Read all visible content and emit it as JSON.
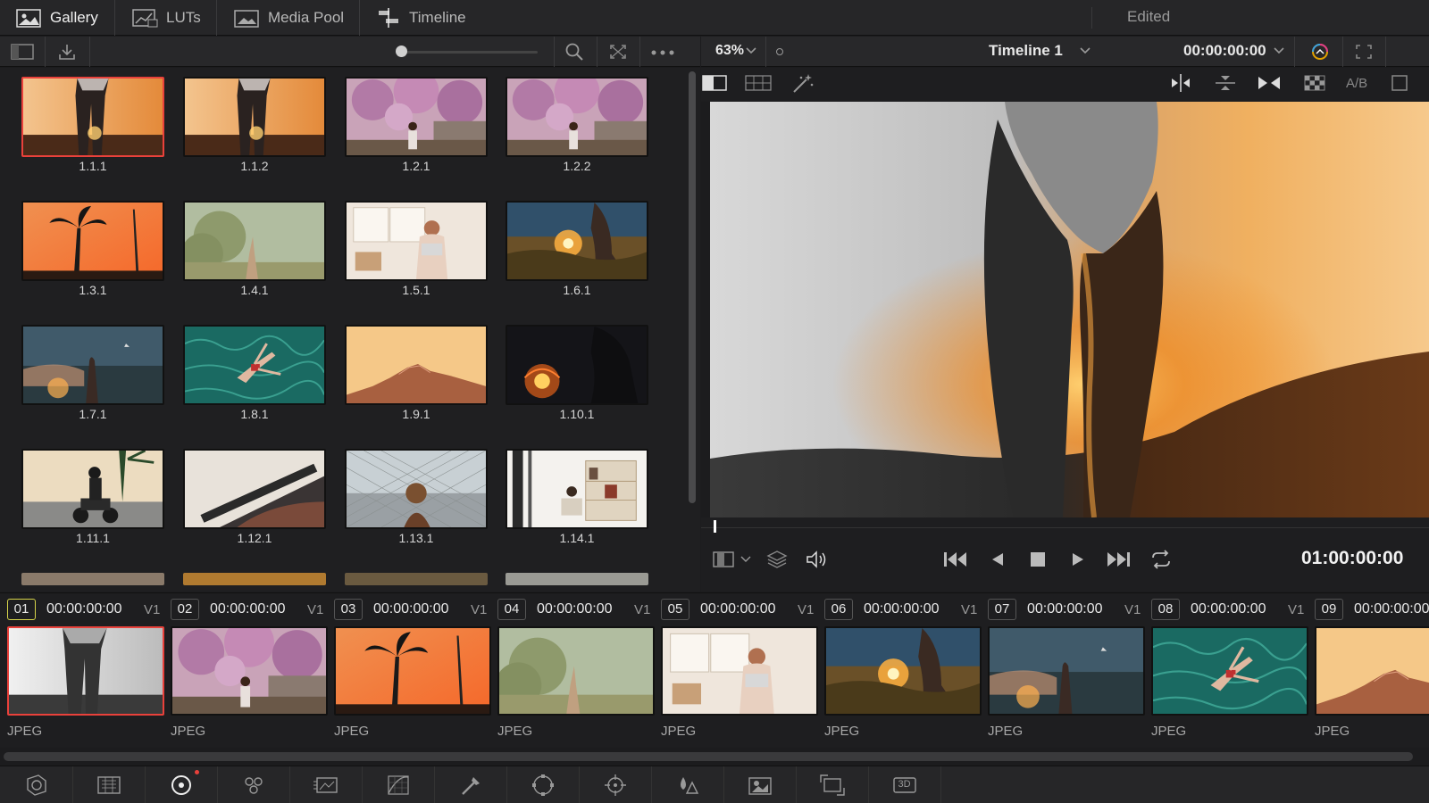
{
  "tabs": [
    {
      "label": "Gallery",
      "icon": "gallery-icon",
      "active": true
    },
    {
      "label": "LUTs",
      "icon": "luts-icon",
      "active": false
    },
    {
      "label": "Media Pool",
      "icon": "media-pool-icon",
      "active": false
    },
    {
      "label": "Timeline",
      "icon": "timeline-icon",
      "active": false
    }
  ],
  "status": "Edited",
  "viewer": {
    "zoom": "63%",
    "timeline_name": "Timeline 1",
    "timecode": "00:00:00:00",
    "ab_label": "A/B",
    "playhead_tc": "01:00:00:00"
  },
  "stills": [
    {
      "label": "1.1.1",
      "scene": "legs"
    },
    {
      "label": "1.1.2",
      "scene": "legs"
    },
    {
      "label": "1.2.1",
      "scene": "blossom"
    },
    {
      "label": "1.2.2",
      "scene": "blossom"
    },
    {
      "label": "1.3.1",
      "scene": "palm"
    },
    {
      "label": "1.4.1",
      "scene": "hill"
    },
    {
      "label": "1.5.1",
      "scene": "room"
    },
    {
      "label": "1.6.1",
      "scene": "field"
    },
    {
      "label": "1.7.1",
      "scene": "beach"
    },
    {
      "label": "1.8.1",
      "scene": "pool"
    },
    {
      "label": "1.9.1",
      "scene": "desert"
    },
    {
      "label": "1.10.1",
      "scene": "fire"
    },
    {
      "label": "1.11.1",
      "scene": "moto"
    },
    {
      "label": "1.12.1",
      "scene": "car"
    },
    {
      "label": "1.13.1",
      "scene": "fence"
    },
    {
      "label": "1.14.1",
      "scene": "shelf"
    }
  ],
  "clips": [
    {
      "num": "01",
      "tc": "00:00:00:00",
      "track": "V1",
      "format": "JPEG",
      "scene": "bwlegs"
    },
    {
      "num": "02",
      "tc": "00:00:00:00",
      "track": "V1",
      "format": "JPEG",
      "scene": "blossom"
    },
    {
      "num": "03",
      "tc": "00:00:00:00",
      "track": "V1",
      "format": "JPEG",
      "scene": "palm"
    },
    {
      "num": "04",
      "tc": "00:00:00:00",
      "track": "V1",
      "format": "JPEG",
      "scene": "hill"
    },
    {
      "num": "05",
      "tc": "00:00:00:00",
      "track": "V1",
      "format": "JPEG",
      "scene": "room"
    },
    {
      "num": "06",
      "tc": "00:00:00:00",
      "track": "V1",
      "format": "JPEG",
      "scene": "field"
    },
    {
      "num": "07",
      "tc": "00:00:00:00",
      "track": "V1",
      "format": "JPEG",
      "scene": "beach"
    },
    {
      "num": "08",
      "tc": "00:00:00:00",
      "track": "V1",
      "format": "JPEG",
      "scene": "pool"
    },
    {
      "num": "09",
      "tc": "00:00:00:00",
      "track": "V1",
      "format": "JPEG",
      "scene": "desert"
    }
  ],
  "bottom_tools": [
    "camera-raw-icon",
    "color-match-icon",
    "color-wheels-icon",
    "rgb-mixer-icon",
    "motion-effects-icon",
    "curves-icon",
    "qualifier-icon",
    "window-icon",
    "tracker-icon",
    "blur-icon",
    "key-icon",
    "sizing-icon",
    "3d-icon"
  ],
  "bottom_3d_label": "3D",
  "colors": {
    "accent": "#e9413b",
    "active_clip": "#d6d44a",
    "bg": "#1c1c1e"
  }
}
